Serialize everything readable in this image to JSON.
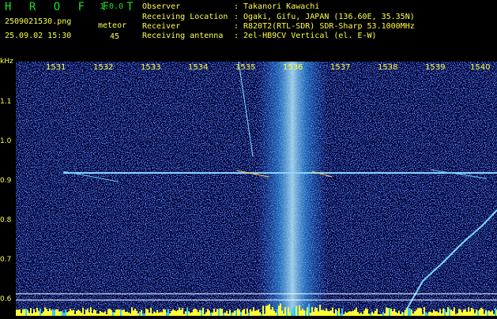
{
  "header": {
    "app_title": "H R O F F T",
    "app_version": "1.0.0",
    "file_name": "2509021530.png",
    "date_time": "25.09.02 15:30",
    "meteor_label": "meteor",
    "meteor_count": "45",
    "info_rows": [
      {
        "key": "Observer",
        "value": "Takanori Kawachi"
      },
      {
        "key": "Receiving Location",
        "value": "Ogaki, Gifu, JAPAN (136.60E, 35.35N)"
      },
      {
        "key": "Receiver",
        "value": "R820T2(RTL-SDR) SDR-Sharp 53.1000MHz"
      },
      {
        "key": "Receiving antenna",
        "value": "2el-HB9CV Vertical (el. E-W)"
      }
    ]
  },
  "spectrogram": {
    "y_unit": "kHz",
    "y_ticks": [
      "1.1",
      "1.0",
      "0.9",
      "0.8",
      "0.7",
      "0.6"
    ],
    "x_ticks": [
      "1531",
      "1532",
      "1533",
      "1534",
      "1535",
      "1536",
      "1537",
      "1538",
      "1539",
      "1540"
    ],
    "colors": {
      "text": "#ffff44",
      "title": "#22dd22",
      "background": "#000033"
    }
  }
}
